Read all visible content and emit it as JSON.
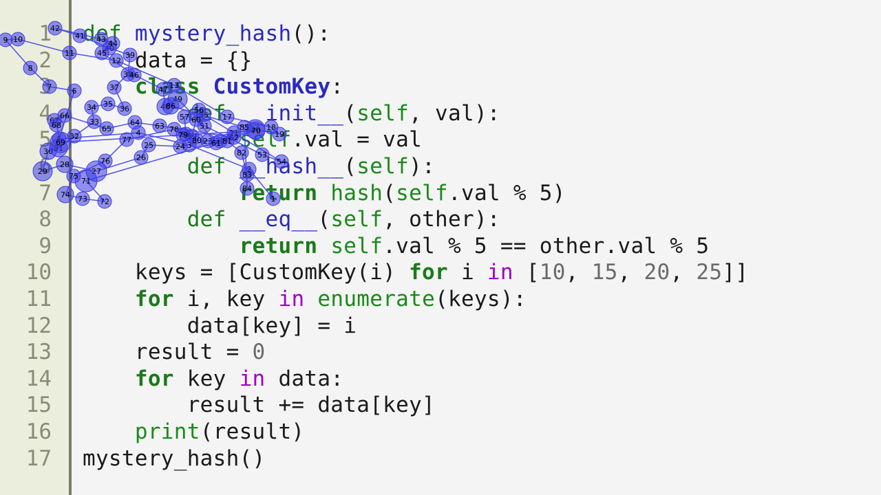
{
  "editor": {
    "lines": [
      {
        "n": "1",
        "tokens": [
          {
            "t": "def ",
            "c": "kw"
          },
          {
            "t": "mystery_hash",
            "c": "fn"
          },
          {
            "t": "():",
            "c": "dflt"
          }
        ]
      },
      {
        "n": "2",
        "tokens": [
          {
            "t": "    data = {}",
            "c": "dflt"
          }
        ]
      },
      {
        "n": "3",
        "tokens": [
          {
            "t": "    ",
            "c": "dflt"
          },
          {
            "t": "class ",
            "c": "kwb"
          },
          {
            "t": "CustomKey",
            "c": "cls"
          },
          {
            "t": ":",
            "c": "dflt"
          }
        ]
      },
      {
        "n": "4",
        "tokens": [
          {
            "t": "        ",
            "c": "dflt"
          },
          {
            "t": "def ",
            "c": "kw"
          },
          {
            "t": "__init__",
            "c": "fn"
          },
          {
            "t": "(",
            "c": "dflt"
          },
          {
            "t": "self",
            "c": "bi"
          },
          {
            "t": ", val):",
            "c": "dflt"
          }
        ]
      },
      {
        "n": "5",
        "tokens": [
          {
            "t": "            ",
            "c": "dflt"
          },
          {
            "t": "self",
            "c": "bi"
          },
          {
            "t": ".val = val",
            "c": "dflt"
          }
        ]
      },
      {
        "n": "6",
        "tokens": [
          {
            "t": "        ",
            "c": "dflt"
          },
          {
            "t": "def ",
            "c": "kw"
          },
          {
            "t": "__hash__",
            "c": "fn"
          },
          {
            "t": "(",
            "c": "dflt"
          },
          {
            "t": "self",
            "c": "bi"
          },
          {
            "t": "):",
            "c": "dflt"
          }
        ]
      },
      {
        "n": "7",
        "tokens": [
          {
            "t": "            ",
            "c": "dflt"
          },
          {
            "t": "return ",
            "c": "kwb"
          },
          {
            "t": "hash",
            "c": "bi"
          },
          {
            "t": "(",
            "c": "dflt"
          },
          {
            "t": "self",
            "c": "bi"
          },
          {
            "t": ".val % 5)",
            "c": "dflt"
          }
        ]
      },
      {
        "n": "8",
        "tokens": [
          {
            "t": "        ",
            "c": "dflt"
          },
          {
            "t": "def ",
            "c": "kw"
          },
          {
            "t": "__eq__",
            "c": "fn"
          },
          {
            "t": "(",
            "c": "dflt"
          },
          {
            "t": "self",
            "c": "bi"
          },
          {
            "t": ", other):",
            "c": "dflt"
          }
        ]
      },
      {
        "n": "9",
        "tokens": [
          {
            "t": "            ",
            "c": "dflt"
          },
          {
            "t": "return ",
            "c": "kwb"
          },
          {
            "t": "self",
            "c": "bi"
          },
          {
            "t": ".val % 5 == other.val % 5",
            "c": "dflt"
          }
        ]
      },
      {
        "n": "10",
        "tokens": [
          {
            "t": "    keys = [CustomKey(i) ",
            "c": "dflt"
          },
          {
            "t": "for",
            "c": "kwb"
          },
          {
            "t": " i ",
            "c": "dflt"
          },
          {
            "t": "in",
            "c": "op"
          },
          {
            "t": " [",
            "c": "dflt"
          },
          {
            "t": "10",
            "c": "num"
          },
          {
            "t": ", ",
            "c": "dflt"
          },
          {
            "t": "15",
            "c": "num"
          },
          {
            "t": ", ",
            "c": "dflt"
          },
          {
            "t": "20",
            "c": "num"
          },
          {
            "t": ", ",
            "c": "dflt"
          },
          {
            "t": "25",
            "c": "num"
          },
          {
            "t": "]]",
            "c": "dflt"
          }
        ]
      },
      {
        "n": "11",
        "tokens": [
          {
            "t": "    ",
            "c": "dflt"
          },
          {
            "t": "for",
            "c": "kwb"
          },
          {
            "t": " i, key ",
            "c": "dflt"
          },
          {
            "t": "in",
            "c": "op"
          },
          {
            "t": " ",
            "c": "dflt"
          },
          {
            "t": "enumerate",
            "c": "bi"
          },
          {
            "t": "(keys):",
            "c": "dflt"
          }
        ]
      },
      {
        "n": "12",
        "tokens": [
          {
            "t": "        data[key] = i",
            "c": "dflt"
          }
        ]
      },
      {
        "n": "13",
        "tokens": [
          {
            "t": "    result = ",
            "c": "dflt"
          },
          {
            "t": "0",
            "c": "num"
          }
        ]
      },
      {
        "n": "14",
        "tokens": [
          {
            "t": "    ",
            "c": "dflt"
          },
          {
            "t": "for",
            "c": "kwb"
          },
          {
            "t": " key ",
            "c": "dflt"
          },
          {
            "t": "in",
            "c": "op"
          },
          {
            "t": " data:",
            "c": "dflt"
          }
        ]
      },
      {
        "n": "15",
        "tokens": [
          {
            "t": "        result += data[key]",
            "c": "dflt"
          }
        ]
      },
      {
        "n": "16",
        "tokens": [
          {
            "t": "    ",
            "c": "dflt"
          },
          {
            "t": "print",
            "c": "bi"
          },
          {
            "t": "(result)",
            "c": "dflt"
          }
        ]
      },
      {
        "n": "17",
        "tokens": [
          {
            "t": "mystery_hash()",
            "c": "dflt"
          }
        ]
      }
    ]
  },
  "trail": {
    "color": "#3c3ce6",
    "points": [
      "1",
      "2",
      "3",
      "4",
      "5",
      "6",
      "7",
      "8",
      "9",
      "10",
      "11",
      "12",
      "13",
      "17",
      "18",
      "19",
      "20",
      "21",
      "22",
      "23",
      "24",
      "25",
      "26",
      "27",
      "28",
      "29",
      "30",
      "31",
      "32",
      "33",
      "34",
      "35",
      "36",
      "37",
      "38",
      "39",
      "40",
      "41",
      "42",
      "43",
      "44",
      "45",
      "46",
      "47",
      "48",
      "49",
      "51",
      "53",
      "54",
      "55",
      "56",
      "57",
      "58",
      "59",
      "60",
      "61",
      "62",
      "63",
      "64",
      "65",
      "66",
      "67",
      "68",
      "69",
      "70",
      "71",
      "72",
      "73",
      "74",
      "75",
      "76",
      "77",
      "78",
      "79",
      "80",
      "81",
      "82",
      "83",
      "84",
      "85",
      "86"
    ]
  }
}
